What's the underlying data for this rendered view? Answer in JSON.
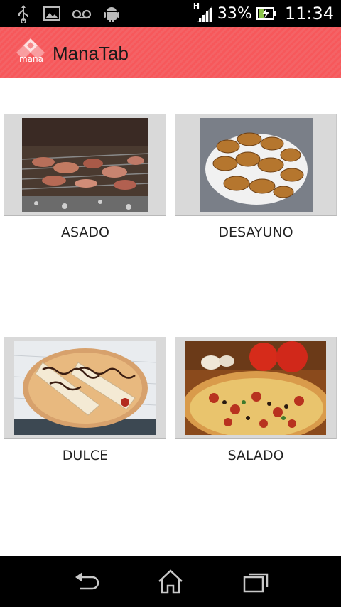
{
  "status_bar": {
    "network_type": "H",
    "battery_percent": "33%",
    "time": "11:34",
    "icons_left": [
      "usb-icon",
      "image-icon",
      "voicemail-icon",
      "android-icon"
    ]
  },
  "action_bar": {
    "logo_text": "mana",
    "title": "ManaTab",
    "color": "#f7585b"
  },
  "categories": [
    {
      "label": "ASADO"
    },
    {
      "label": "DESAYUNO"
    },
    {
      "label": "DULCE"
    },
    {
      "label": "SALADO"
    }
  ],
  "nav_bar": {
    "buttons": [
      "back-icon",
      "home-icon",
      "recent-apps-icon"
    ]
  }
}
